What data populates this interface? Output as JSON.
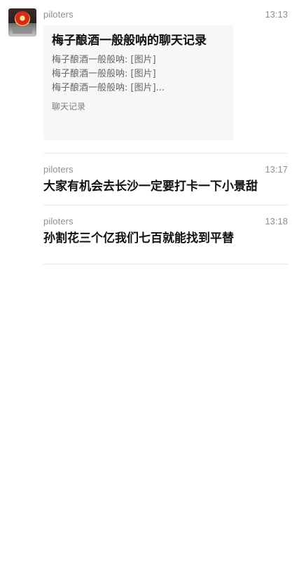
{
  "messages": [
    {
      "sender": "piloters",
      "time": "13:13",
      "card": {
        "title": "梅子酿酒一般般呐的聊天记录",
        "lines": [
          "梅子酿酒一般般呐: [图片]",
          "梅子酿酒一般般呐: [图片]",
          "梅子酿酒一般般呐: [图片]..."
        ],
        "footer": "聊天记录"
      }
    },
    {
      "sender": "piloters",
      "time": "13:17",
      "text": "大家有机会去长沙一定要打卡一下小景甜"
    },
    {
      "sender": "piloters",
      "time": "13:18",
      "text": "孙割花三个亿我们七百就能找到平替"
    }
  ],
  "colors": {
    "background": "#ffffff",
    "card_background": "#f7f7f7",
    "meta_text": "#8f8f8f",
    "primary_text": "#111111",
    "divider": "#e9e9e9"
  },
  "icons": {
    "avatar": "profile-avatar-icon"
  }
}
